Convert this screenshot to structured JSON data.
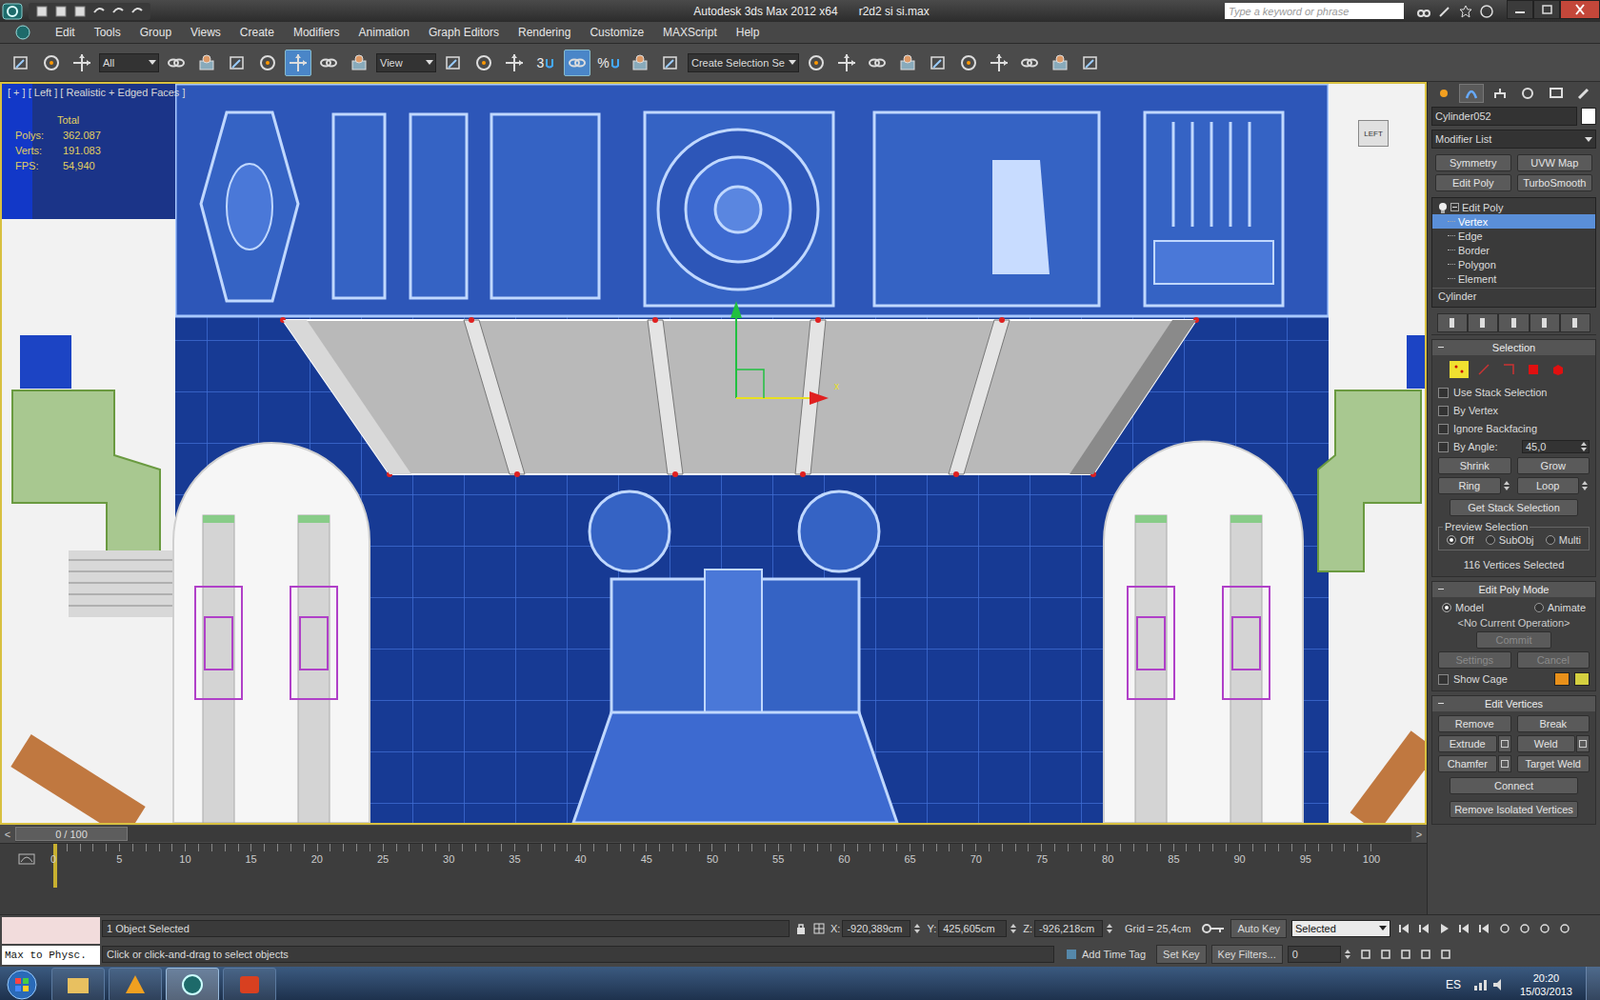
{
  "window": {
    "title": "Autodesk 3ds Max  2012 x64",
    "file": "r2d2 si si.max"
  },
  "search": {
    "placeholder": "Type a keyword or phrase"
  },
  "menu": [
    "Edit",
    "Tools",
    "Group",
    "Views",
    "Create",
    "Modifiers",
    "Animation",
    "Graph Editors",
    "Rendering",
    "Customize",
    "MAXScript",
    "Help"
  ],
  "toolbar": {
    "items": [
      {
        "kind": "icon",
        "selected": false
      },
      {
        "kind": "icon",
        "selected": false
      },
      {
        "kind": "icon",
        "selected": false
      },
      {
        "kind": "dropdown",
        "value": "All"
      },
      {
        "kind": "icon",
        "selected": false
      },
      {
        "kind": "icon",
        "selected": false
      },
      {
        "kind": "icon",
        "selected": false
      },
      {
        "kind": "icon",
        "selected": false
      },
      {
        "kind": "icon",
        "selected": true
      },
      {
        "kind": "icon",
        "selected": false
      },
      {
        "kind": "icon",
        "selected": false
      },
      {
        "kind": "dropdown",
        "value": "View"
      },
      {
        "kind": "icon",
        "selected": false
      },
      {
        "kind": "icon",
        "selected": false
      },
      {
        "kind": "icon",
        "selected": false
      },
      {
        "kind": "snap",
        "text": "3",
        "selected": false
      },
      {
        "kind": "icon",
        "selected": true
      },
      {
        "kind": "snap",
        "text": "%",
        "selected": false
      },
      {
        "kind": "icon",
        "selected": false
      },
      {
        "kind": "icon",
        "selected": false
      },
      {
        "kind": "dropdown",
        "value": "Create Selection Se"
      },
      {
        "kind": "icon",
        "selected": false
      },
      {
        "kind": "icon",
        "selected": false
      },
      {
        "kind": "icon",
        "selected": false
      },
      {
        "kind": "icon",
        "selected": false
      },
      {
        "kind": "icon",
        "selected": false
      },
      {
        "kind": "icon",
        "selected": false
      },
      {
        "kind": "icon",
        "selected": false
      },
      {
        "kind": "icon",
        "selected": false
      },
      {
        "kind": "icon",
        "selected": false
      },
      {
        "kind": "icon",
        "selected": false
      }
    ]
  },
  "viewport": {
    "label": "[ + ] [ Left ] [ Realistic + Edged Faces ]",
    "stats_header": "Total",
    "stats": [
      {
        "label": "Polys:",
        "value": "362.087"
      },
      {
        "label": "Verts:",
        "value": "191.083"
      },
      {
        "label": "FPS:",
        "value": "54,940"
      }
    ],
    "viewcube": "LEFT",
    "axis_x": "x"
  },
  "command_panel": {
    "tabs": [
      {
        "selected": false
      },
      {
        "selected": true
      },
      {
        "selected": false
      },
      {
        "selected": false
      },
      {
        "selected": false
      },
      {
        "selected": false
      }
    ],
    "object_name": "Cylinder052",
    "object_color": "#ffffff",
    "modifier_list": "Modifier List",
    "modifier_buttons": [
      "Symmetry",
      "UVW Map",
      "Edit Poly",
      "TurboSmooth"
    ],
    "stack": [
      {
        "label": "Edit Poly",
        "kind": "modifier",
        "selected": false
      },
      {
        "label": "Vertex",
        "kind": "subobject",
        "selected": true
      },
      {
        "label": "Edge",
        "kind": "subobject",
        "selected": false
      },
      {
        "label": "Border",
        "kind": "subobject",
        "selected": false
      },
      {
        "label": "Polygon",
        "kind": "subobject",
        "selected": false
      },
      {
        "label": "Element",
        "kind": "subobject",
        "selected": false
      },
      {
        "label": "Cylinder",
        "kind": "base",
        "selected": false
      }
    ],
    "selection": {
      "title": "Selection",
      "modes": [
        {
          "selected": true
        },
        {
          "selected": false
        },
        {
          "selected": false
        },
        {
          "selected": false
        },
        {
          "selected": false
        }
      ],
      "checkboxes": [
        {
          "label": "Use Stack Selection",
          "checked": false
        },
        {
          "label": "By Vertex",
          "checked": false
        },
        {
          "label": "Ignore Backfacing",
          "checked": false
        }
      ],
      "angle": {
        "label": "By Angle:",
        "checked": false,
        "value": "45,0"
      },
      "buttons": [
        "Shrink",
        "Grow"
      ],
      "spinner_buttons": [
        "Ring",
        "Loop"
      ],
      "get_stack": "Get Stack Selection",
      "preview_title": "Preview Selection",
      "preview_options": [
        {
          "label": "Off",
          "selected": true
        },
        {
          "label": "SubObj",
          "selected": false
        },
        {
          "label": "Multi",
          "selected": false
        }
      ],
      "status": "116 Vertices Selected"
    },
    "edit_poly_mode": {
      "title": "Edit Poly Mode",
      "options": [
        {
          "label": "Model",
          "selected": true
        },
        {
          "label": "Animate",
          "selected": false
        }
      ],
      "operation": "<No Current Operation>",
      "commit": {
        "label": "Commit",
        "disabled": true
      },
      "buttons": [
        {
          "label": "Settings",
          "disabled": true
        },
        {
          "label": "Cancel",
          "disabled": true
        }
      ],
      "show_cage": {
        "label": "Show Cage",
        "checked": false
      },
      "cage_colors": [
        "#e8901a",
        "#d4d040"
      ]
    },
    "edit_vertices": {
      "title": "Edit Vertices",
      "buttons": [
        {
          "label": "Remove",
          "settings": false
        },
        {
          "label": "Break",
          "settings": false
        },
        {
          "label": "Extrude",
          "settings": true
        },
        {
          "label": "Weld",
          "settings": true
        },
        {
          "label": "Chamfer",
          "settings": true
        },
        {
          "label": "Target Weld",
          "settings": false
        }
      ],
      "wide_buttons": [
        "Connect",
        "Remove Isolated Vertices"
      ]
    }
  },
  "timeline": {
    "slider": "0 / 100",
    "level": 0,
    "prev": "<",
    "next": ">",
    "ticks": [
      "0",
      "5",
      "10",
      "15",
      "20",
      "25",
      "30",
      "35",
      "40",
      "45",
      "50",
      "55",
      "60",
      "65",
      "70",
      "75",
      "80",
      "85",
      "90",
      "95",
      "100"
    ]
  },
  "status_bar": {
    "script_label": "Max to Physc.",
    "selection": "1 Object Selected",
    "prompt": "Click or click-and-drag to select objects",
    "coords": [
      {
        "axis": "X:",
        "value": "-920,389cm"
      },
      {
        "axis": "Y:",
        "value": "425,605cm"
      },
      {
        "axis": "Z:",
        "value": "-926,218cm"
      }
    ],
    "grid": "Grid = 25,4cm",
    "auto_key": "Auto Key",
    "key_mode": "Selected",
    "set_key": "Set Key",
    "key_filters": "Key Filters...",
    "time_tag": "Add Time Tag",
    "frame": "0"
  },
  "taskbar": {
    "apps": [
      {
        "selected": false
      },
      {
        "selected": false
      },
      {
        "selected": true
      },
      {
        "selected": false
      }
    ],
    "language": "ES",
    "time": "20:20",
    "date": "15/03/2013"
  }
}
